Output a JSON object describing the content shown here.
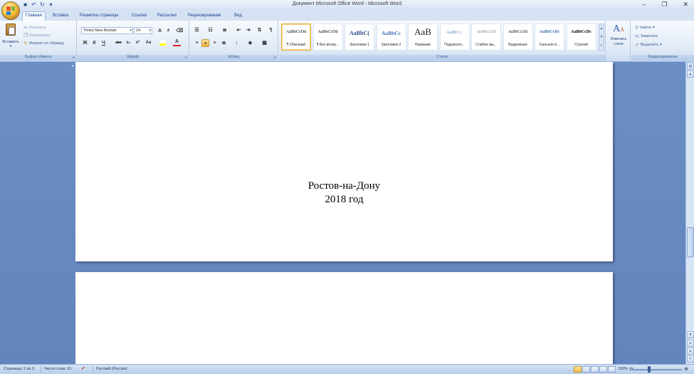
{
  "window": {
    "title": "Документ Microsoft Office Word - Microsoft Word",
    "minimize_glyph": "–",
    "restore_glyph": "❐",
    "close_glyph": "✕"
  },
  "qat": [
    "save-icon",
    "undo-icon",
    "redo-icon",
    "customize-icon"
  ],
  "tabs": [
    "Главная",
    "Вставка",
    "Разметка страницы",
    "Ссылки",
    "Рассылки",
    "Рецензирование",
    "Вид"
  ],
  "clipboard": {
    "paste": "Вставить",
    "cut": "Вырезать",
    "copy": "Копировать",
    "format_painter": "Формат по образцу",
    "label": "Буфер обмена"
  },
  "font": {
    "name": "Times New Roman",
    "size": "14",
    "label": "Шрифт",
    "bold": "Ж",
    "italic": "К",
    "underline": "Ч",
    "strike": "abc",
    "subscript": "x₂",
    "superscript": "x²",
    "change_case": "Aa",
    "grow": "A",
    "shrink": "A"
  },
  "paragraph": {
    "label": "Абзац"
  },
  "styles": {
    "label": "Стили",
    "items": [
      {
        "sample": "AaBbCcDd",
        "name": "¶ Обычный"
      },
      {
        "sample": "AaBbCcDd",
        "name": "¶ Без интер..."
      },
      {
        "sample": "AaBbC(",
        "name": "Заголовок 1"
      },
      {
        "sample": "AaBbCc",
        "name": "Заголовок 2"
      },
      {
        "sample": "AaB",
        "name": "Название"
      },
      {
        "sample": "AaBbCc.",
        "name": "Подзаголо..."
      },
      {
        "sample": "AaBbCcDd",
        "name": "Слабое вы..."
      },
      {
        "sample": "AaBbCcDd",
        "name": "Выделение"
      },
      {
        "sample": "AaBbCcDc",
        "name": "Сильное в..."
      },
      {
        "sample": "AaBbCcDc",
        "name": "Строгий"
      }
    ],
    "change_styles": "Изменить стили"
  },
  "editing": {
    "label": "Редактирование",
    "find": "Найти",
    "replace": "Заменить",
    "select": "Выделить"
  },
  "document": {
    "line1": "Ростов-на-Дону",
    "line2": "2018 год"
  },
  "status": {
    "page": "Страница: 2 из 3",
    "words": "Число слов: 61",
    "language": "Русский (Россия)",
    "zoom": "150%"
  }
}
